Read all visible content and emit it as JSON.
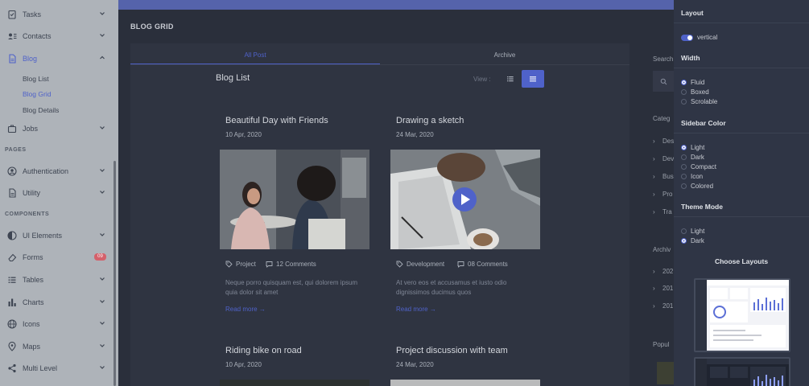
{
  "sidebar": {
    "menu": {
      "tasks": "Tasks",
      "contacts": "Contacts",
      "blog": "Blog",
      "jobs": "Jobs",
      "authentication": "Authentication",
      "utility": "Utility",
      "ui_elements": "UI Elements",
      "forms": "Forms",
      "forms_badge": "09",
      "tables": "Tables",
      "charts": "Charts",
      "icons": "Icons",
      "maps": "Maps",
      "multi_level": "Multi Level"
    },
    "blog_sub": [
      "Blog List",
      "Blog Grid",
      "Blog Details"
    ],
    "sections": {
      "pages": "PAGES",
      "components": "COMPONENTS"
    }
  },
  "main": {
    "page_title": "BLOG GRID",
    "tabs": {
      "all": "All Post",
      "archive": "Archive"
    },
    "list_title": "Blog List",
    "view_label": "View :",
    "posts": [
      {
        "title": "Beautiful Day with Friends",
        "date": "10 Apr, 2020",
        "category": "Project",
        "comments": "12 Comments",
        "excerpt": "Neque porro quisquam est, qui dolorem ipsum quia dolor sit amet",
        "read_more": "Read more"
      },
      {
        "title": "Drawing a sketch",
        "date": "24 Mar, 2020",
        "category": "Development",
        "comments": "08 Comments",
        "excerpt": "At vero eos et accusamus et iusto odio dignissimos ducimus quos",
        "read_more": "Read more"
      },
      {
        "title": "Riding bike on road",
        "date": "10 Apr, 2020"
      },
      {
        "title": "Project discussion with team",
        "date": "24 Mar, 2020"
      }
    ]
  },
  "right_col": {
    "search": "Search",
    "categories": "Categ",
    "cat_items": [
      "Des",
      "Dev",
      "Bus",
      "Pro",
      "Tra"
    ],
    "archive": "Archiv",
    "archive_items": [
      "202",
      "201",
      "201"
    ],
    "popular": "Popul"
  },
  "panel": {
    "layout": {
      "title": "Layout",
      "value": "vertical"
    },
    "width": {
      "title": "Width",
      "options": [
        "Fluid",
        "Boxed",
        "Scrolable"
      ],
      "selected": "Fluid"
    },
    "sidebar_color": {
      "title": "Sidebar Color",
      "options": [
        "Light",
        "Dark",
        "Compact",
        "Icon",
        "Colored"
      ],
      "selected": "Light"
    },
    "theme_mode": {
      "title": "Theme Mode",
      "options": [
        "Light",
        "Dark"
      ],
      "selected": "Dark"
    },
    "choose_layouts": "Choose Layouts"
  },
  "colors": {
    "accent": "#4f62c9",
    "topbar": "#5563ab",
    "background": "#2a2f3b",
    "sidebar": "#aeb3b9",
    "panel": "#2f3545"
  }
}
